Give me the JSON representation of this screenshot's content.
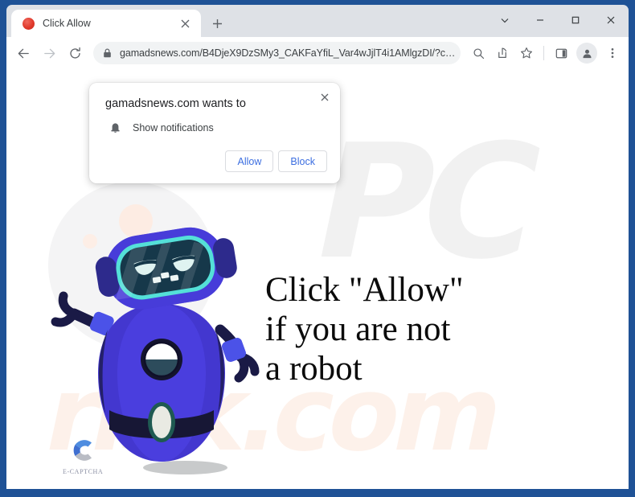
{
  "browser": {
    "tab": {
      "title": "Click Allow",
      "favicon": "red-circle-favicon",
      "close_label": "×"
    },
    "new_tab_label": "+",
    "window_controls": {
      "chevron": "⌵",
      "minimize": "−",
      "maximize": "□",
      "close": "✕"
    },
    "nav": {
      "back": "back-arrow",
      "forward": "forward-arrow",
      "reload": "reload-arrow"
    },
    "omnibox": {
      "lock": "lock-icon",
      "url": "gamadsnews.com/B4DjeX9DzSMy3_CAKFaYfiL_Var4wJjlT4i1AMlgzDI/?c…"
    },
    "toolbar_icons": [
      "zoom-search-icon",
      "share-icon",
      "bookmark-star-icon",
      "side-panel-icon",
      "profile-avatar-icon",
      "three-dot-menu-icon"
    ]
  },
  "permission_dialog": {
    "title": "gamadsnews.com wants to",
    "permission_icon": "bell-icon",
    "permission_label": "Show notifications",
    "allow_label": "Allow",
    "block_label": "Block",
    "close_label": "✕",
    "accent_color": "#3c6ee0"
  },
  "page": {
    "headline_lines": [
      "Click \"Allow\"",
      "if you are not",
      "a robot"
    ],
    "brand_name": "E-CAPTCHA",
    "brand_logo": "c-letter-logo",
    "mascot": "blue-robot-mascot",
    "watermark_top": "PC",
    "watermark_bottom": "risk.com",
    "robot_colors": {
      "body": "#4337cf",
      "body_light": "#4b3fe0",
      "screen": "#16384a",
      "screen_border": "#54e0d8",
      "arm": "#1a1a46",
      "belt": "#161632"
    }
  }
}
